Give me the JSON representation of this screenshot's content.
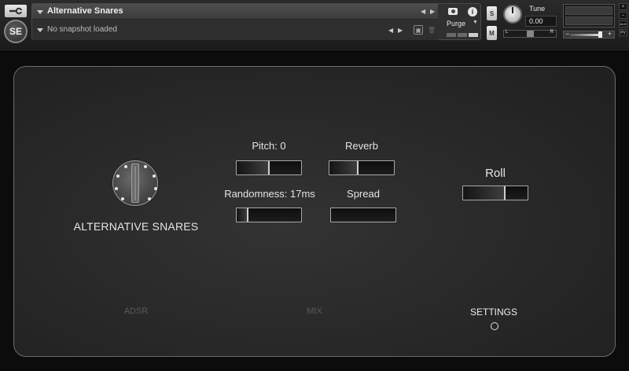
{
  "header": {
    "instrument_name": "Alternative Snares",
    "snapshot": "No snapshot loaded",
    "logo": "SE",
    "purge_label": "Purge",
    "solo_label": "S",
    "mute_label": "M",
    "tune_label": "Tune",
    "tune_value": "0.00",
    "pan_left": "L",
    "pan_right": "R",
    "vol_minus": "−",
    "vol_plus": "+",
    "side_buttons": [
      "×",
      "−",
      "AUX",
      "PV"
    ],
    "icons": [
      "wrench-icon",
      "camera-icon",
      "info-icon",
      "save-icon",
      "trash-icon"
    ]
  },
  "panel": {
    "title": "ALTERNATIVE SNARES",
    "controls": {
      "pitch": {
        "label": "Pitch: 0",
        "value_fraction": 0.5
      },
      "reverb": {
        "label": "Reverb",
        "value_fraction": 0.44
      },
      "randomness": {
        "label": "Randomness: 17ms",
        "value_fraction": 0.17
      },
      "spread": {
        "label": "Spread",
        "value_fraction": 0.0
      },
      "roll": {
        "label": "Roll",
        "value_fraction": 0.65
      }
    },
    "tabs": [
      {
        "label": "ADSR",
        "active": false
      },
      {
        "label": "MIX",
        "active": false
      },
      {
        "label": "SETTINGS",
        "active": true
      }
    ]
  }
}
